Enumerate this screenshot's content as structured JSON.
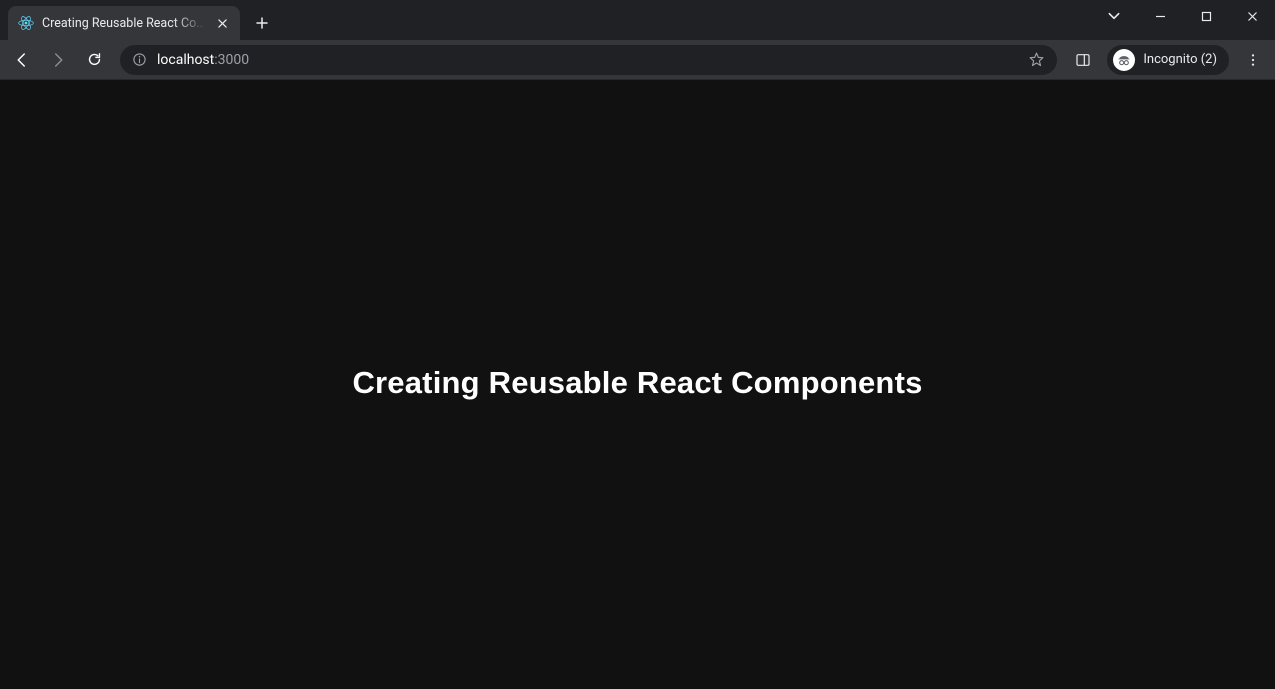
{
  "browser": {
    "tab_title": "Creating Reusable React Components",
    "url_host": "localhost",
    "url_port": ":3000",
    "incognito_label": "Incognito (2)"
  },
  "page": {
    "heading": "Creating Reusable React Components"
  }
}
